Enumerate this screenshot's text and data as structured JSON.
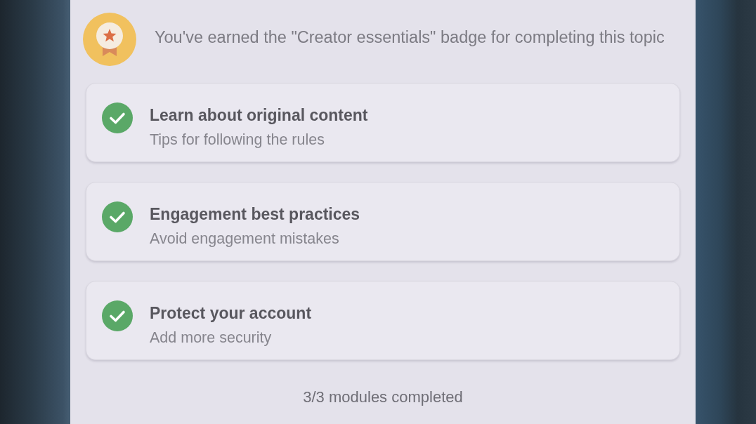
{
  "badge_banner": {
    "text": "You've earned the \"Creator essentials\" badge for completing this topic"
  },
  "modules": [
    {
      "title": "Learn about original content",
      "subtitle": "Tips for following the rules",
      "completed": true
    },
    {
      "title": "Engagement best practices",
      "subtitle": "Avoid engagement mistakes",
      "completed": true
    },
    {
      "title": "Protect your account",
      "subtitle": "Add more security",
      "completed": true
    }
  ],
  "progress_text": "3/3 modules completed"
}
